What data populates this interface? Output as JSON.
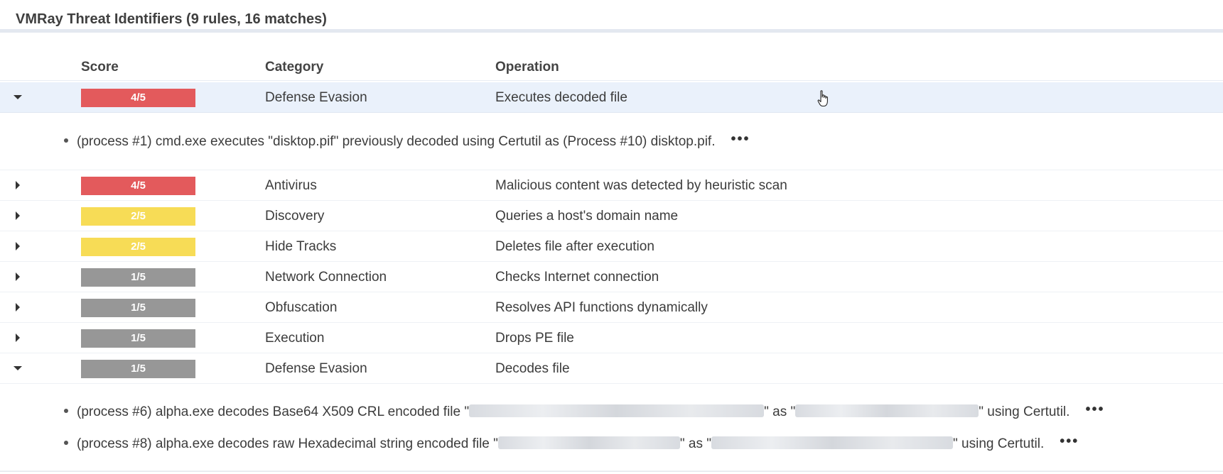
{
  "header": {
    "title": "VMRay Threat Identifiers (9 rules, 16 matches)"
  },
  "columns": {
    "score": "Score",
    "category": "Category",
    "operation": "Operation"
  },
  "colors": {
    "high": "#e35a5c",
    "medium": "#f7dc56",
    "low": "#979797",
    "selected_row": "#eaf1fb"
  },
  "rows": [
    {
      "expanded": true,
      "score": "4/5",
      "level": "high",
      "category": "Defense Evasion",
      "operation": "Executes decoded file"
    },
    {
      "expanded": false,
      "score": "4/5",
      "level": "high",
      "category": "Antivirus",
      "operation": "Malicious content was detected by heuristic scan"
    },
    {
      "expanded": false,
      "score": "2/5",
      "level": "medium",
      "category": "Discovery",
      "operation": "Queries a host's domain name"
    },
    {
      "expanded": false,
      "score": "2/5",
      "level": "medium",
      "category": "Hide Tracks",
      "operation": "Deletes file after execution"
    },
    {
      "expanded": false,
      "score": "1/5",
      "level": "low",
      "category": "Network Connection",
      "operation": "Checks Internet connection"
    },
    {
      "expanded": false,
      "score": "1/5",
      "level": "low",
      "category": "Obfuscation",
      "operation": "Resolves API functions dynamically"
    },
    {
      "expanded": false,
      "score": "1/5",
      "level": "low",
      "category": "Execution",
      "operation": "Drops PE file"
    },
    {
      "expanded": true,
      "score": "1/5",
      "level": "low",
      "category": "Defense Evasion",
      "operation": "Decodes file"
    }
  ],
  "details": {
    "d0": {
      "text": "(process #1) cmd.exe executes \"disktop.pif\" previously decoded using Certutil as (Process #10) disktop.pif."
    },
    "d1": {
      "pre": "(process #6) alpha.exe decodes Base64 X509 CRL encoded file \"",
      "mid": "\" as \"",
      "post": "\" using Certutil."
    },
    "d2": {
      "pre": "(process #8) alpha.exe decodes raw Hexadecimal string encoded file \"",
      "mid": "\" as \"",
      "post": "\" using Certutil."
    }
  },
  "more_label": "•••",
  "icons": {
    "expanded": "caret-down-icon",
    "collapsed": "caret-right-icon",
    "cursor": "hand-cursor-icon",
    "more": "more-options-icon"
  }
}
